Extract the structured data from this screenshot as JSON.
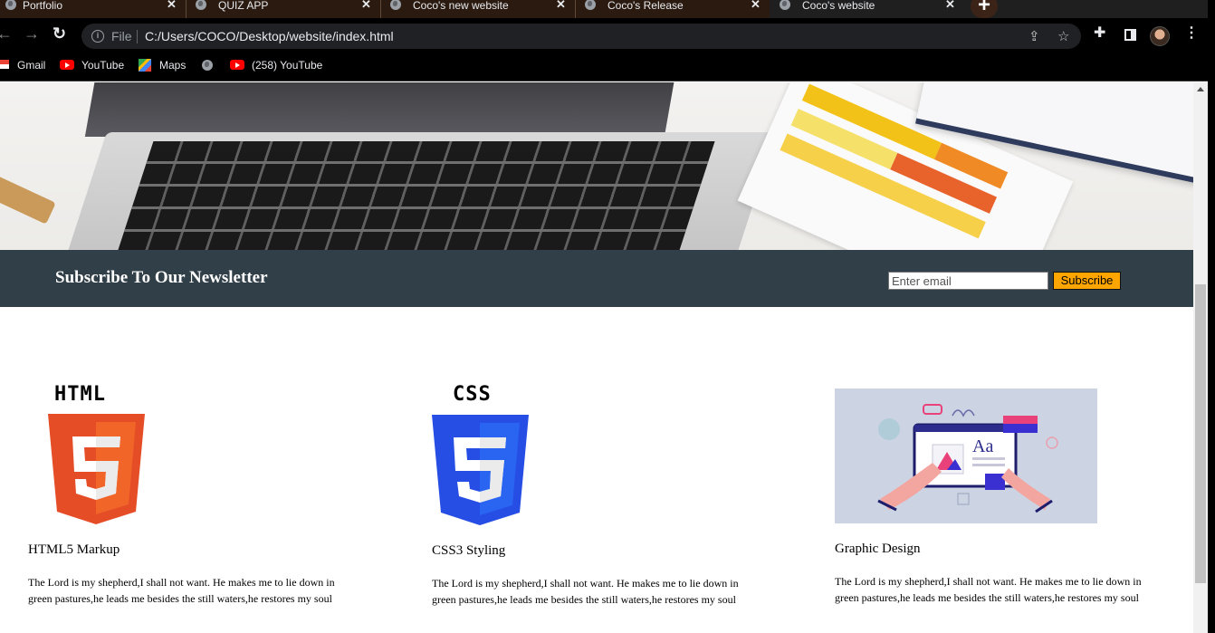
{
  "browser": {
    "tabs": [
      {
        "title": "Portfolio",
        "active": false
      },
      {
        "title": "QUIZ APP",
        "active": false
      },
      {
        "title": "Coco's new website",
        "active": false
      },
      {
        "title": "Coco's Release",
        "active": false
      },
      {
        "title": "Coco's website",
        "active": true
      }
    ],
    "close_glyph": "✕",
    "new_tab_glyph": "+",
    "omnibox": {
      "scheme_label": "File",
      "url": "C:/Users/COCO/Desktop/website/index.html"
    },
    "bookmarks": [
      {
        "label": "Gmail",
        "icon": "gmail-icon"
      },
      {
        "label": "YouTube",
        "icon": "youtube-icon"
      },
      {
        "label": "Maps",
        "icon": "maps-icon"
      },
      {
        "label": "",
        "icon": "globe-icon"
      },
      {
        "label": "(258) YouTube",
        "icon": "youtube-icon"
      }
    ]
  },
  "newsletter": {
    "title": "Subscribe To Our Newsletter",
    "email_placeholder": "Enter email",
    "button_label": "Subscribe"
  },
  "services": [
    {
      "logo_text": "HTML",
      "title": "HTML5 Markup",
      "description": "The Lord is my shepherd,I shall not want. He makes me to lie down in green pastures,he leads me besides the still waters,he restores my soul"
    },
    {
      "logo_text": "CSS",
      "title": "CSS3 Styling",
      "description": "The Lord is my shepherd,I shall not want. He makes me to lie down in green pastures,he leads me besides the still waters,he restores my soul"
    },
    {
      "logo_text": "Aa",
      "title": "Graphic Design",
      "description": "The Lord is my shepherd,I shall not want. He makes me to lie down in green pastures,he leads me besides the still waters,he restores my soul"
    }
  ],
  "colors": {
    "newsletter_bg": "#313f48",
    "subscribe_button": "#ffa500",
    "html5_orange": "#e44d26",
    "css3_blue": "#264de4"
  }
}
